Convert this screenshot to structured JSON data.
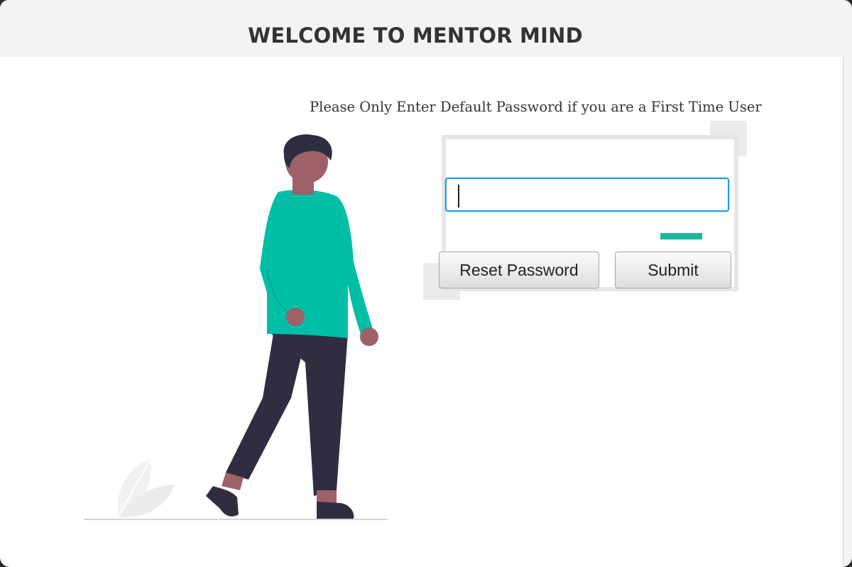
{
  "header": {
    "title": "WELCOME TO MENTOR MIND"
  },
  "form": {
    "info_text": "Please Only Enter Default Password if you are a First Time User",
    "password_value": "",
    "reset_label": "Reset Password",
    "submit_label": "Submit"
  },
  "colors": {
    "accent": "#1cb89e",
    "input_focus": "#1f9de0",
    "figure_shirt": "#00bfa6",
    "figure_pants": "#2f2e41",
    "figure_skin": "#9e616a"
  },
  "icons": {
    "illustration": "person-walking-illustration",
    "leaf": "leaf-icon"
  }
}
